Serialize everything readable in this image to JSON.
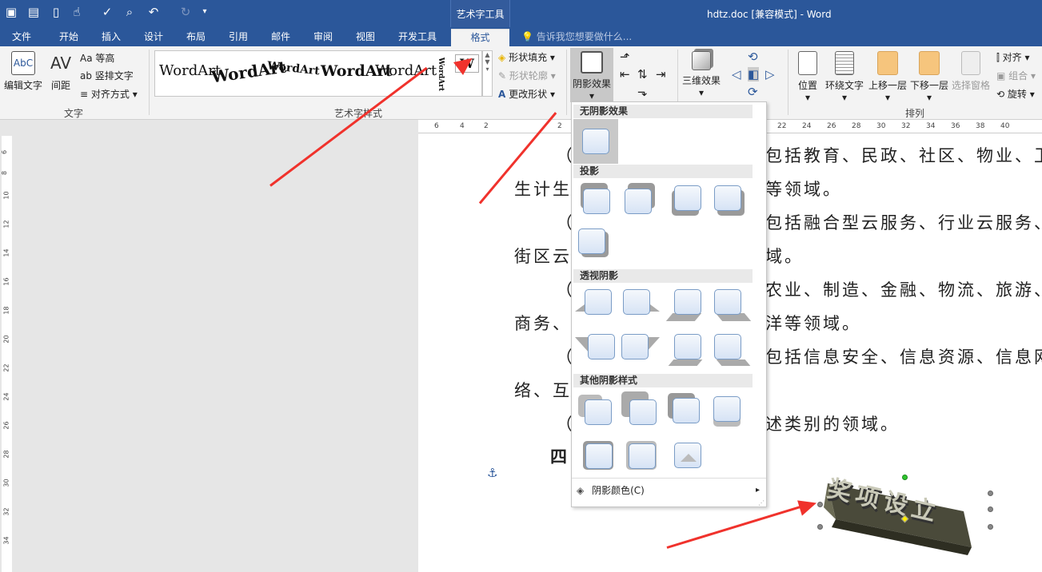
{
  "title_bar": {
    "context_group": "艺术字工具",
    "document_title": "hdtz.doc [兼容模式] - Word"
  },
  "tabs": [
    "文件",
    "开始",
    "插入",
    "设计",
    "布局",
    "引用",
    "邮件",
    "审阅",
    "视图",
    "开发工具",
    "格式"
  ],
  "tell_me": "告诉我您想要做什么...",
  "ribbon": {
    "text_group": {
      "label": "文字",
      "edit_text": "编辑文字",
      "spacing": "间距",
      "equal_height": "等高",
      "vertical_text": "竖排文字",
      "align_text": "对齐方式"
    },
    "wordart_group": {
      "label": "艺术字样式",
      "samples": [
        "WordArt",
        "WordArt",
        "WordArt",
        "WordArt",
        "WordArt",
        "WordArt",
        "W"
      ],
      "shape_fill": "形状填充",
      "shape_outline": "形状轮廓",
      "change_shape": "更改形状"
    },
    "shadow_effect": "阴影效果",
    "three_d": "三维效果",
    "arrange_group": {
      "label": "排列",
      "position": "位置",
      "wrap_text": "环绕文字",
      "bring_forward": "上移一层",
      "send_backward": "下移一层",
      "selection_pane": "选择窗格",
      "align": "对齐",
      "group": "组合",
      "rotate": "旋转"
    }
  },
  "ruler_numbers": [
    "6",
    "4",
    "2",
    "2",
    "22",
    "24",
    "26",
    "28",
    "30",
    "32",
    "34",
    "36",
    "38",
    "40"
  ],
  "vruler_numbers": [
    "6",
    "8",
    "10",
    "12",
    "14",
    "16",
    "18",
    "20",
    "22",
    "24",
    "26",
    "28",
    "30",
    "32",
    "34"
  ],
  "document_lines": [
    "（",
    "包括教育、民政、社区、物业、卫",
    "生计生",
    "等领域。",
    "（",
    "包括融合型云服务、行业云服务、",
    "街区云",
    "域。",
    "（",
    "农业、制造、金融、物流、旅游、",
    "商务、",
    "洋等领域。",
    "（",
    "包括信息安全、信息资源、信息网",
    "络、互",
    "（",
    "述类别的领域。",
    "四"
  ],
  "shadow_menu": {
    "no_shadow": "无阴影效果",
    "drop_shadow": "投影",
    "perspective_shadow": "透视阴影",
    "other_shadow": "其他阴影样式",
    "shadow_color": "阴影颜色(C)"
  },
  "art_text": "奖项设立"
}
